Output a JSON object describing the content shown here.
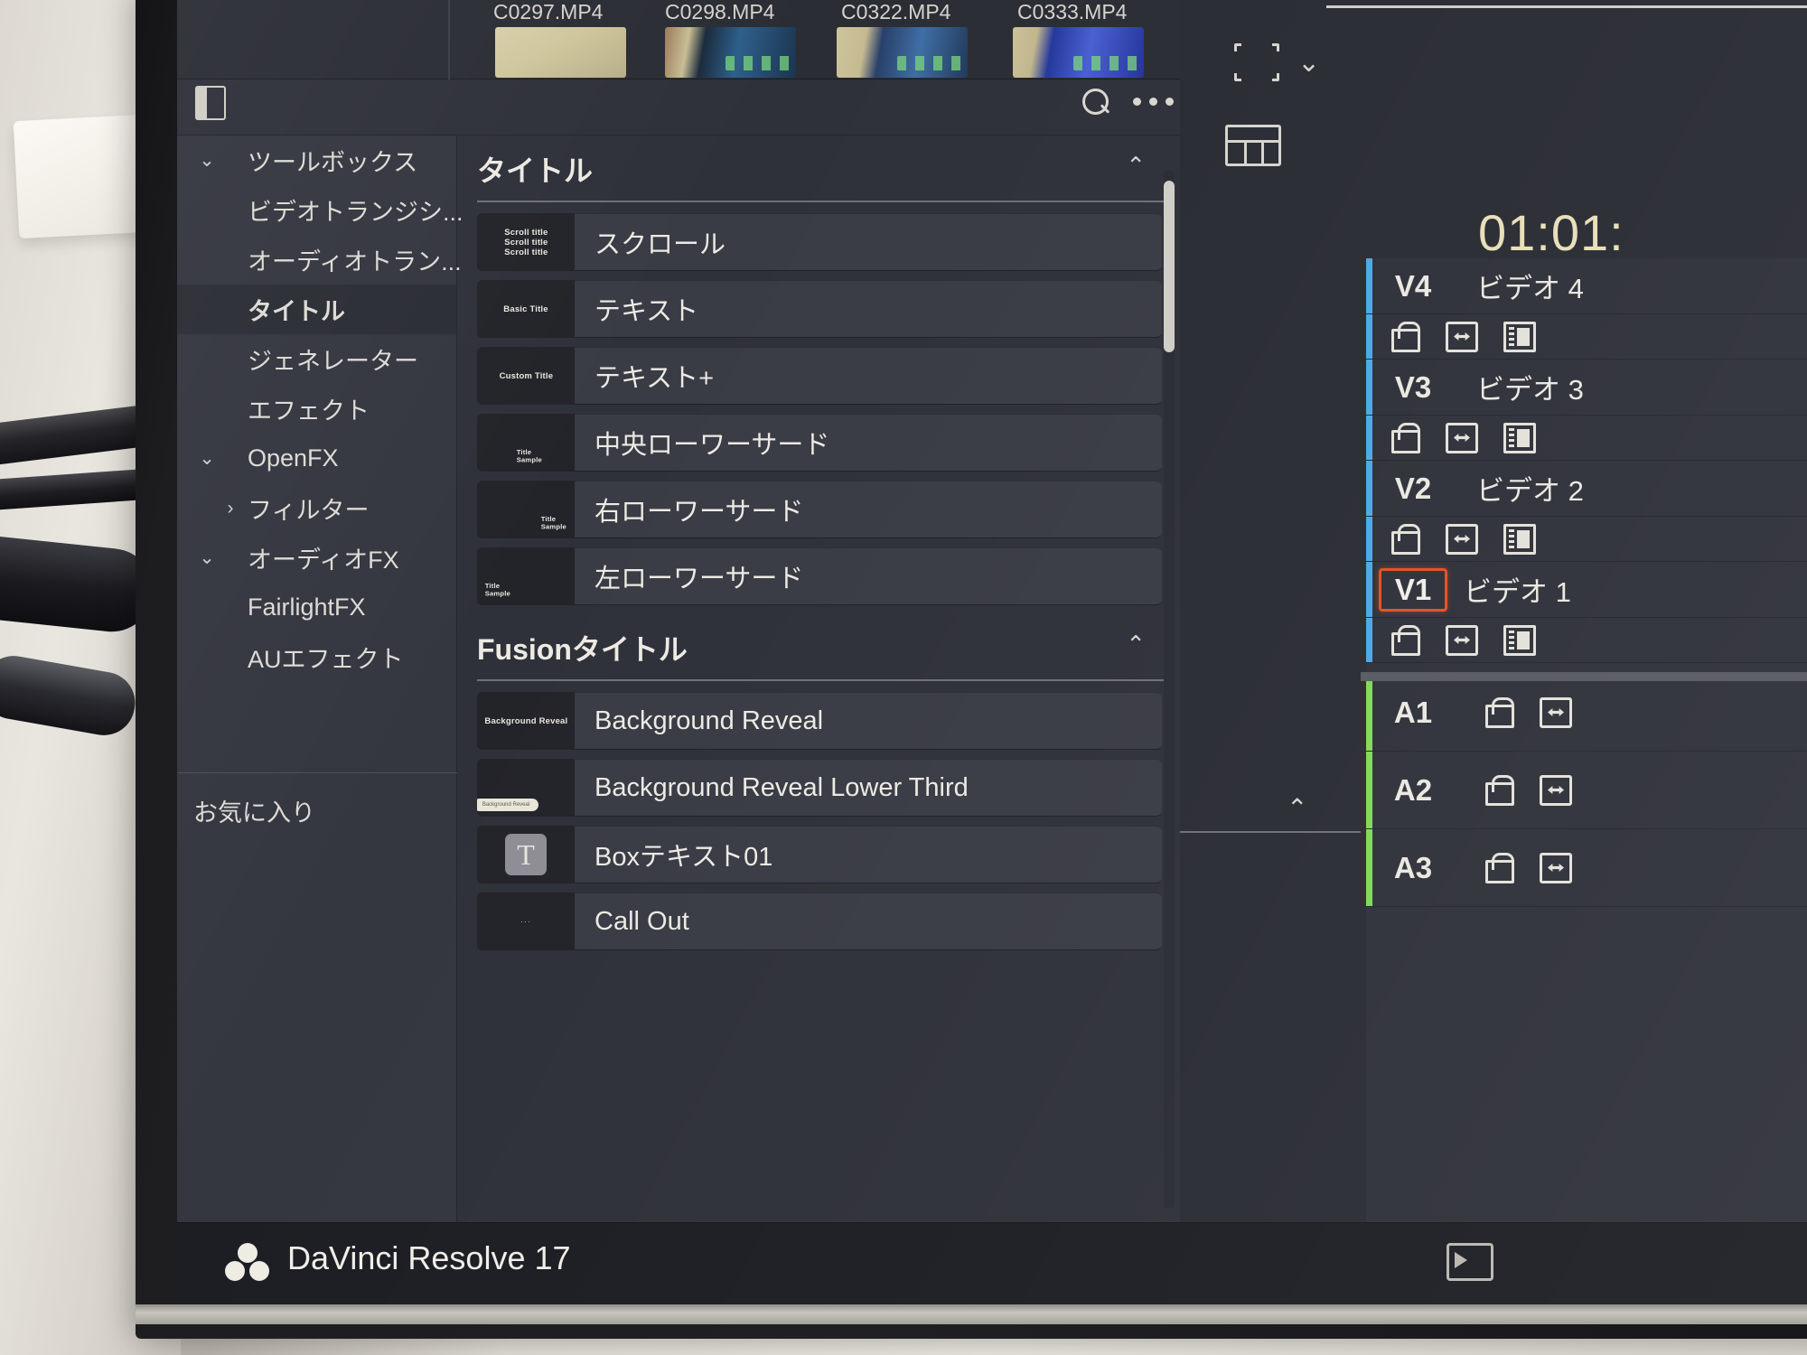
{
  "app": {
    "name": "DaVinci Resolve 17",
    "logo_icon": "resolve-logo-icon",
    "render_icon": "render-queue-icon"
  },
  "media_pool": {
    "files": [
      "C0297.MP4",
      "C0298.MP4",
      "C0322.MP4",
      "C0333.MP4"
    ]
  },
  "effects_panel": {
    "toolbar": {
      "panel_toggle_icon": "panel-toggle-icon",
      "search_icon": "search-icon",
      "more_icon": "more-options-icon"
    },
    "tree": [
      {
        "label": "ツールボックス",
        "chevron": "⌄",
        "level": 0,
        "selected": false
      },
      {
        "label": "ビデオトランジシ...",
        "chevron": "",
        "level": 1,
        "selected": false
      },
      {
        "label": "オーディオトラン...",
        "chevron": "",
        "level": 1,
        "selected": false
      },
      {
        "label": "タイトル",
        "chevron": "",
        "level": 1,
        "selected": true
      },
      {
        "label": "ジェネレーター",
        "chevron": "",
        "level": 1,
        "selected": false
      },
      {
        "label": "エフェクト",
        "chevron": "",
        "level": 1,
        "selected": false
      },
      {
        "label": "OpenFX",
        "chevron": "⌄",
        "level": 0,
        "selected": false
      },
      {
        "label": "フィルター",
        "chevron": "›",
        "level": 1,
        "selected": false
      },
      {
        "label": "オーディオFX",
        "chevron": "⌄",
        "level": 0,
        "selected": false
      },
      {
        "label": "FairlightFX",
        "chevron": "",
        "level": 1,
        "selected": false
      },
      {
        "label": "AUエフェクト",
        "chevron": "",
        "level": 1,
        "selected": false
      }
    ],
    "favorites_label": "お気に入り",
    "sections": [
      {
        "title": "タイトル",
        "collapse_caret": "⌃",
        "items": [
          {
            "name": "スクロール",
            "thumb_kind": "scroll",
            "thumb_text": "Scroll title"
          },
          {
            "name": "テキスト",
            "thumb_kind": "text",
            "thumb_text": "Basic Title"
          },
          {
            "name": "テキスト+",
            "thumb_kind": "text",
            "thumb_text": "Custom Title"
          },
          {
            "name": "中央ローワーサード",
            "thumb_kind": "sample",
            "thumb_text": "Title\nSample"
          },
          {
            "name": "右ローワーサード",
            "thumb_kind": "sample-right",
            "thumb_text": "Title\nSample"
          },
          {
            "name": "左ローワーサード",
            "thumb_kind": "sample-left",
            "thumb_text": "Title\nSample"
          }
        ]
      },
      {
        "title": "Fusionタイトル",
        "collapse_caret": "⌃",
        "items": [
          {
            "name": "Background Reveal",
            "thumb_kind": "bgreveal",
            "thumb_text": "Background Reveal"
          },
          {
            "name": "Background Reveal Lower Third",
            "thumb_kind": "bgreveal-lower",
            "thumb_text": "Background Reveal"
          },
          {
            "name": "Boxテキスト01",
            "thumb_kind": "tbox",
            "thumb_text": "T"
          },
          {
            "name": "Call Out",
            "thumb_kind": "callout",
            "thumb_text": "···"
          }
        ]
      }
    ]
  },
  "viewer": {
    "crop_icon": "crop-frame-icon",
    "crop_chevron": "⌄",
    "timeline_icon": "timeline-view-icon",
    "timecode": "01:01:"
  },
  "timeline": {
    "collapse_chevron": "⌃",
    "tracks": [
      {
        "id": "V4",
        "label": "ビデオ 4",
        "kind": "video",
        "selected": false,
        "controls": [
          "lock-icon",
          "auto-track-select-icon",
          "track-visibility-icon"
        ]
      },
      {
        "id": "V3",
        "label": "ビデオ 3",
        "kind": "video",
        "selected": false,
        "controls": [
          "lock-icon",
          "auto-track-select-icon",
          "track-visibility-icon"
        ]
      },
      {
        "id": "V2",
        "label": "ビデオ 2",
        "kind": "video",
        "selected": false,
        "controls": [
          "lock-icon",
          "auto-track-select-icon",
          "track-visibility-icon"
        ]
      },
      {
        "id": "V1",
        "label": "ビデオ 1",
        "kind": "video",
        "selected": true,
        "controls": [
          "lock-icon",
          "auto-track-select-icon",
          "track-visibility-icon"
        ]
      },
      {
        "id": "A1",
        "label": "",
        "kind": "audio",
        "selected": false,
        "controls": [
          "lock-icon",
          "auto-track-select-icon"
        ]
      },
      {
        "id": "A2",
        "label": "",
        "kind": "audio",
        "selected": false,
        "controls": [
          "lock-icon",
          "auto-track-select-icon"
        ]
      },
      {
        "id": "A3",
        "label": "",
        "kind": "audio",
        "selected": false,
        "controls": [
          "lock-icon",
          "auto-track-select-icon"
        ]
      }
    ]
  },
  "colors": {
    "panel_bg": "#2f313a",
    "tree_bg": "#343640",
    "selected_row": "#2b2d35",
    "item_bg": "#393b45",
    "thumb_bg": "#232429",
    "text": "#eceae3",
    "timecode": "#e8dfb6",
    "video_track_edge": "#4aa8e8",
    "audio_track_edge": "#7ed957",
    "active_track_outline": "#e8501f",
    "statusbar_bg": "#1c1e24"
  }
}
